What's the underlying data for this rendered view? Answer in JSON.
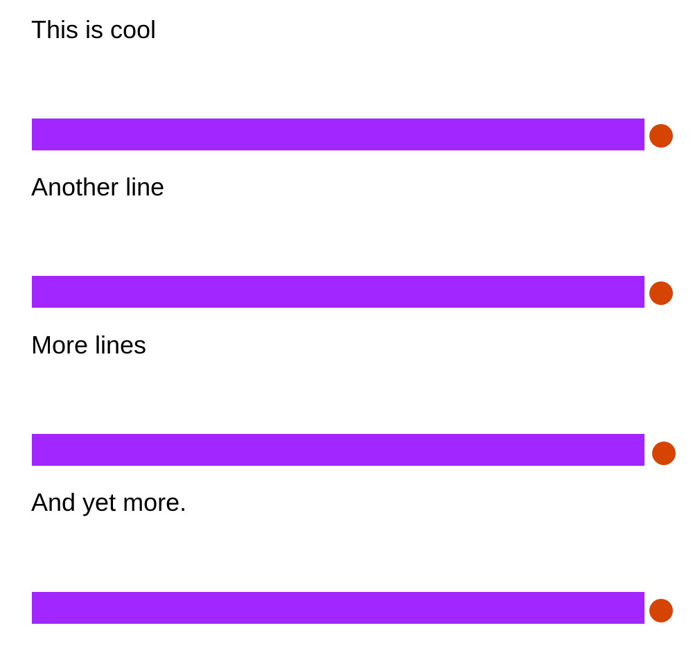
{
  "colors": {
    "bar": "#a226ff",
    "dot": "#d64404",
    "text": "#000000",
    "background": "#ffffff"
  },
  "items": [
    {
      "text": "This is cool"
    },
    {
      "text": "Another line"
    },
    {
      "text": "More lines"
    },
    {
      "text": "And yet more."
    }
  ]
}
